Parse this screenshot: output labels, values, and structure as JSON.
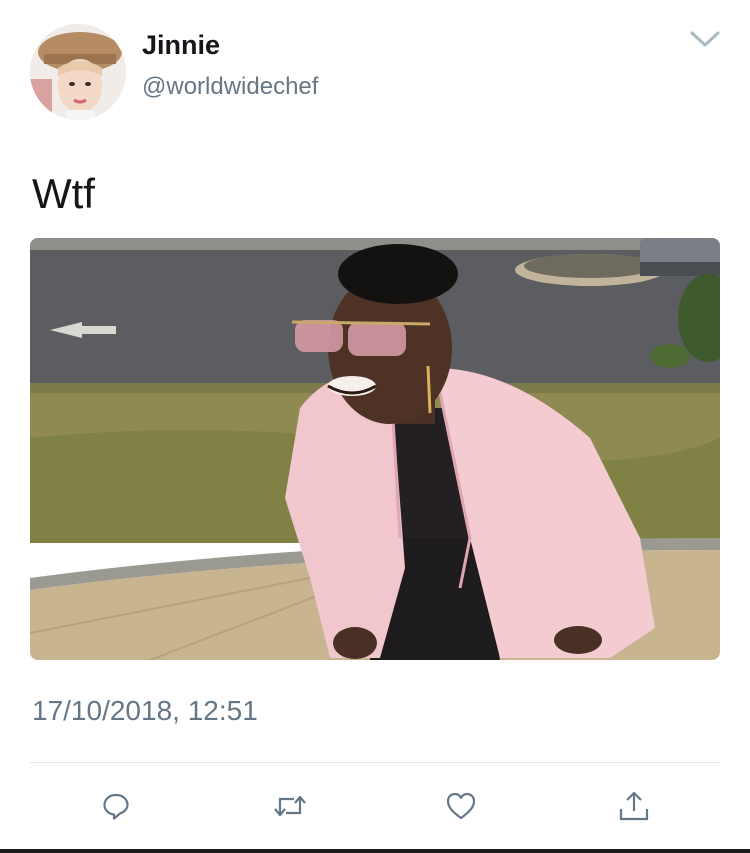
{
  "author": {
    "name": "Jinnie",
    "handle": "@worldwidechef"
  },
  "tweet": {
    "text": "Wtf",
    "timestamp": "17/10/2018, 12:51"
  },
  "icons": {
    "menu": "chevron-down-icon",
    "reply": "reply-icon",
    "retweet": "retweet-icon",
    "like": "heart-icon",
    "share": "share-icon"
  },
  "colors": {
    "text": "#14171a",
    "secondary": "#657786",
    "divider": "#e1e8ed",
    "icon": "#657786"
  }
}
